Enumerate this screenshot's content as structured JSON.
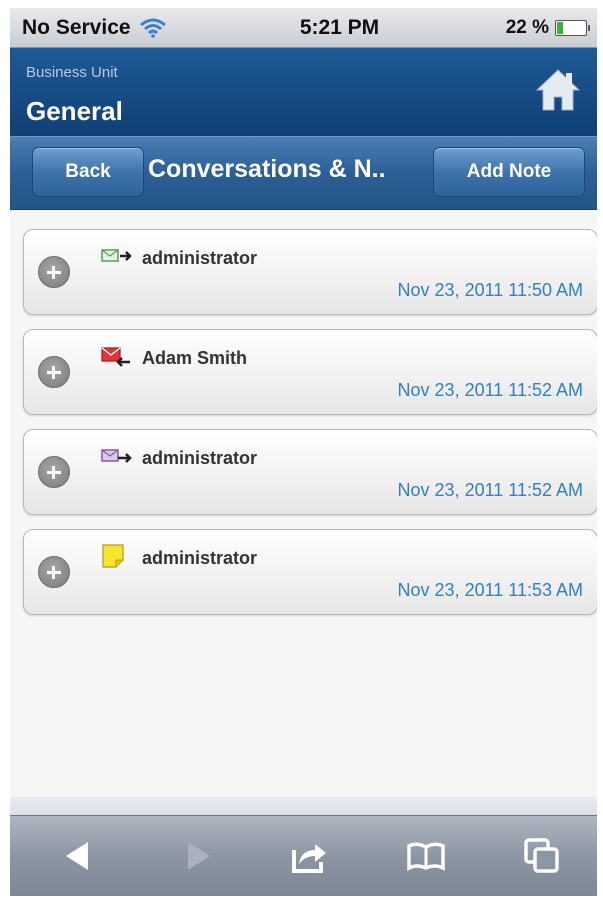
{
  "status_bar": {
    "carrier": "No Service",
    "time": "5:21 PM",
    "battery": "22 %",
    "battery_level": 0.22
  },
  "header": {
    "label": "Business Unit",
    "name": "General"
  },
  "toolbar": {
    "back_label": "Back",
    "title": "Conversations & N..",
    "add_label": "Add Note"
  },
  "items": [
    {
      "name": "administrator",
      "date": "Nov 23, 2011 11:50 AM",
      "icon": "outgoing-email-icon",
      "icon_color": "#5a9e5a"
    },
    {
      "name": "Adam Smith",
      "date": "Nov 23, 2011 11:52 AM",
      "icon": "incoming-email-icon",
      "icon_color": "#d9262b"
    },
    {
      "name": "administrator",
      "date": "Nov 23, 2011 11:52 AM",
      "icon": "forward-email-icon",
      "icon_color": "#8a5aa6"
    },
    {
      "name": "administrator",
      "date": "Nov 23, 2011 11:53 AM",
      "icon": "note-icon",
      "icon_color": "#f1e23a"
    }
  ],
  "colors": {
    "header_bg": "#164b85",
    "toolbar_bg": "#2c5f97",
    "date_text": "#2f7fd0"
  }
}
